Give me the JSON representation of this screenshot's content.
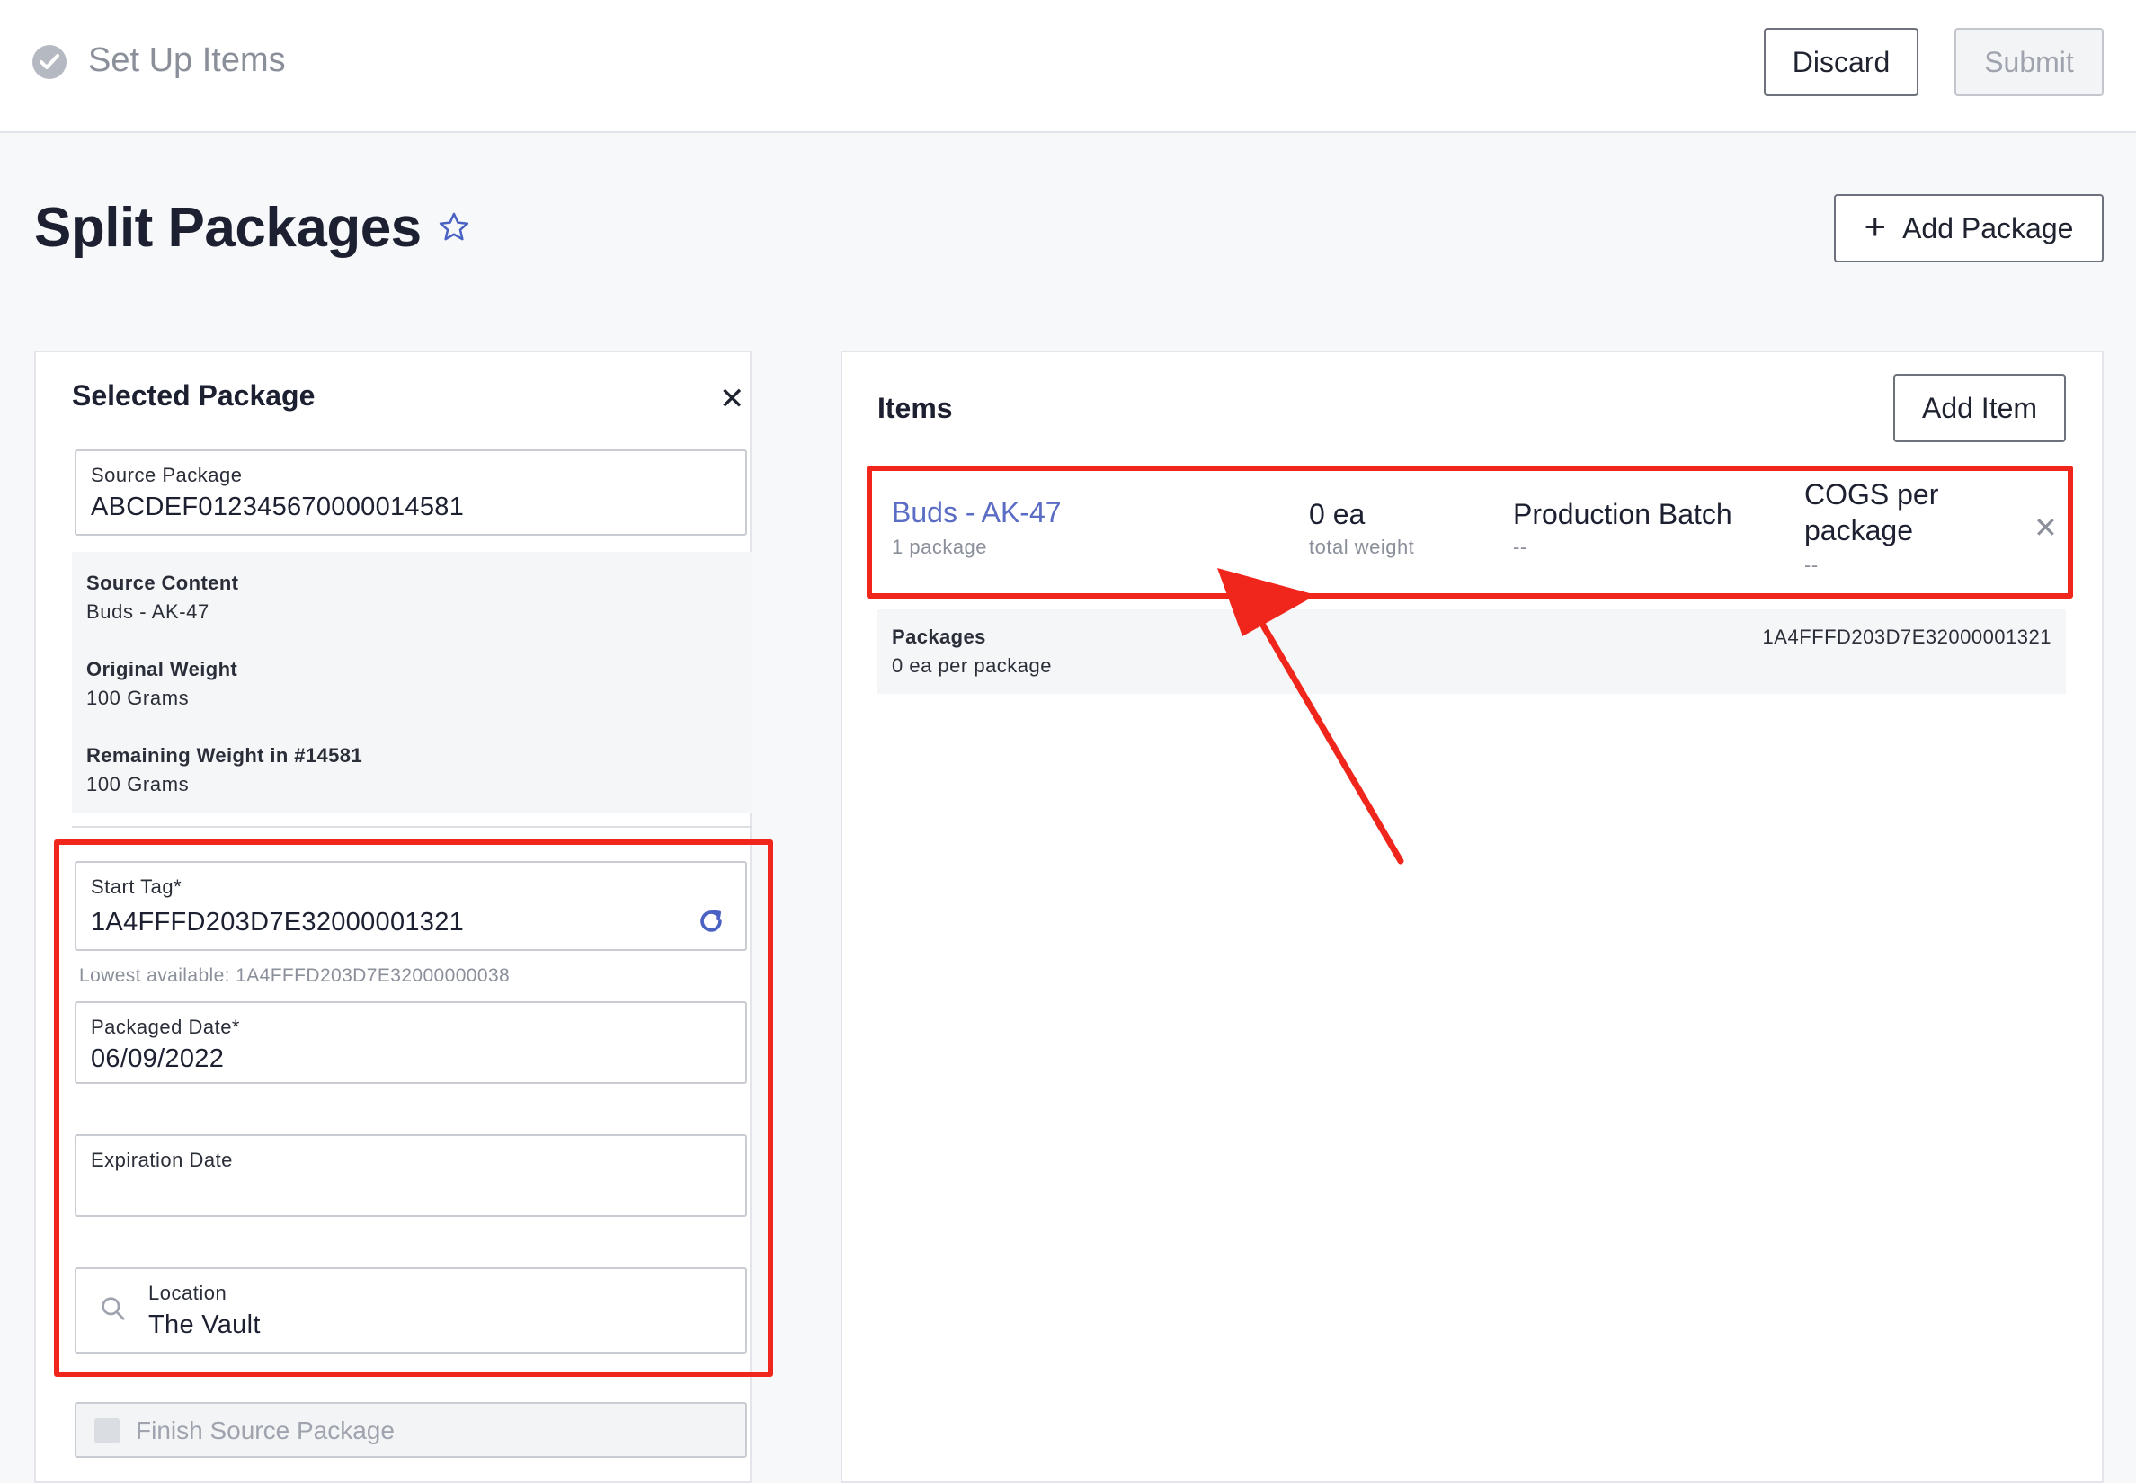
{
  "header": {
    "title": "Set Up Items",
    "discard_label": "Discard",
    "submit_label": "Submit"
  },
  "page": {
    "title": "Split Packages",
    "add_package_label": "Add Package"
  },
  "selected_package": {
    "heading": "Selected Package",
    "source_package_label": "Source Package",
    "source_package_value": "ABCDEF012345670000014581",
    "source_content_label": "Source Content",
    "source_content_value": "Buds - AK-47",
    "original_weight_label": "Original Weight",
    "original_weight_value": "100 Grams",
    "remaining_weight_label": "Remaining Weight in #14581",
    "remaining_weight_value": "100 Grams",
    "start_tag_label": "Start Tag*",
    "start_tag_value": "1A4FFFD203D7E32000001321",
    "lowest_available": "Lowest available: 1A4FFFD203D7E32000000038",
    "packaged_date_label": "Packaged Date*",
    "packaged_date_value": "06/09/2022",
    "expiration_date_label": "Expiration Date",
    "expiration_date_value": "",
    "location_label": "Location",
    "location_value": "The Vault",
    "finish_label": "Finish Source Package"
  },
  "items": {
    "heading": "Items",
    "add_item_label": "Add Item",
    "rows": [
      {
        "name": "Buds - AK-47",
        "count": "1 package",
        "quantity": "0 ea",
        "quantity_sub": "total weight",
        "batch_label": "Production Batch",
        "batch_value": "--",
        "cogs_label_line1": "COGS per",
        "cogs_label_line2": "package",
        "cogs_value": "--"
      }
    ],
    "packages": {
      "label": "Packages",
      "per_package": "0 ea per package",
      "tag": "1A4FFFD203D7E32000001321"
    }
  },
  "colors": {
    "link": "#5a6cc4",
    "annotation": "#f0261c",
    "icon_accent": "#4a62c4"
  }
}
